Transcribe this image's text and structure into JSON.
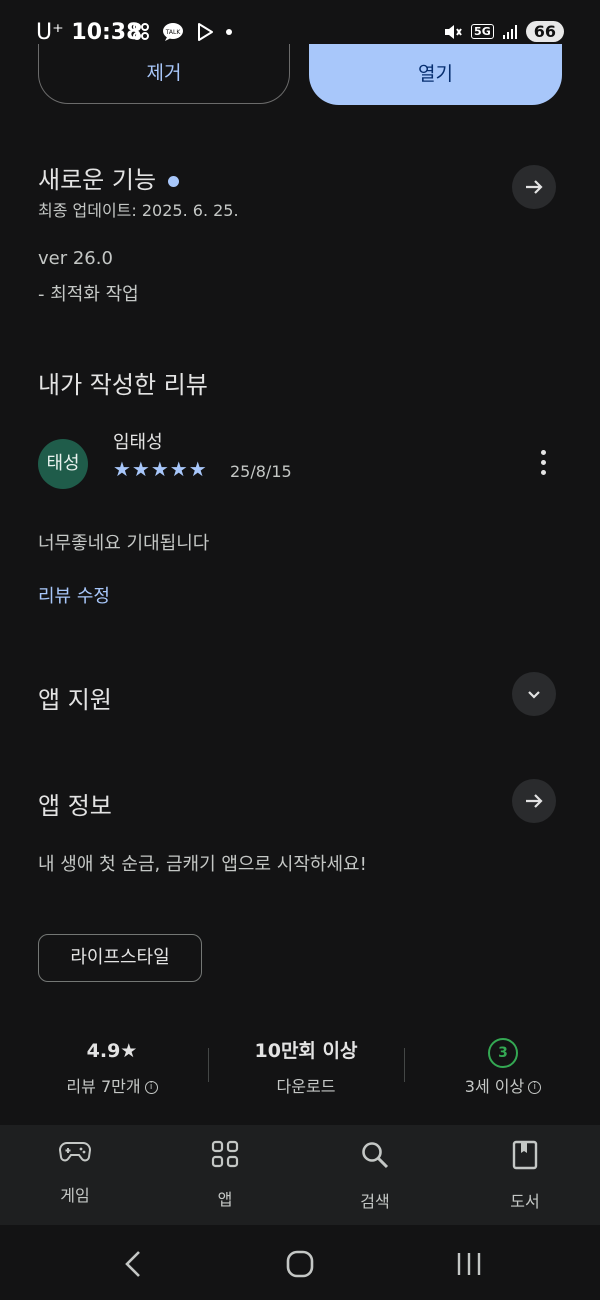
{
  "status_bar": {
    "carrier": "U⁺",
    "time": "10:38",
    "network": "5G",
    "battery": "66",
    "icons": [
      "app-icon",
      "talk-icon",
      "play-icon",
      "dot-icon"
    ]
  },
  "actions": {
    "remove_label": "제거",
    "open_label": "열기"
  },
  "whats_new": {
    "title": "새로운 기능",
    "last_updated": "최종 업데이트: 2025. 6. 25.",
    "version": "ver 26.0",
    "notes": "- 최적화 작업"
  },
  "my_review": {
    "title": "내가 작성한 리뷰",
    "avatar_text": "태성",
    "author": "임태성",
    "rating": 5,
    "stars": "★★★★★",
    "date": "25/8/15",
    "text": "너무좋네요 기대됩니다",
    "edit_label": "리뷰 수정"
  },
  "app_support": {
    "title": "앱 지원"
  },
  "app_info": {
    "title": "앱 정보",
    "description": "내 생애 첫 순금, 금캐기 앱으로 시작하세요!",
    "category": "라이프스타일"
  },
  "stats": {
    "rating": "4.9★",
    "reviews": "리뷰 7만개",
    "downloads": "10만회 이상",
    "downloads_label": "다운로드",
    "age_badge": "3",
    "age_label": "3세 이상"
  },
  "bottom_nav": {
    "items": [
      {
        "label": "게임",
        "icon": "gamepad-icon"
      },
      {
        "label": "앱",
        "icon": "apps-grid-icon"
      },
      {
        "label": "검색",
        "icon": "search-icon"
      },
      {
        "label": "도서",
        "icon": "book-icon"
      }
    ]
  },
  "colors": {
    "background": "#131314",
    "accent": "#a8c7fa",
    "avatar": "#1f5c4a",
    "age_green": "#34a853"
  }
}
